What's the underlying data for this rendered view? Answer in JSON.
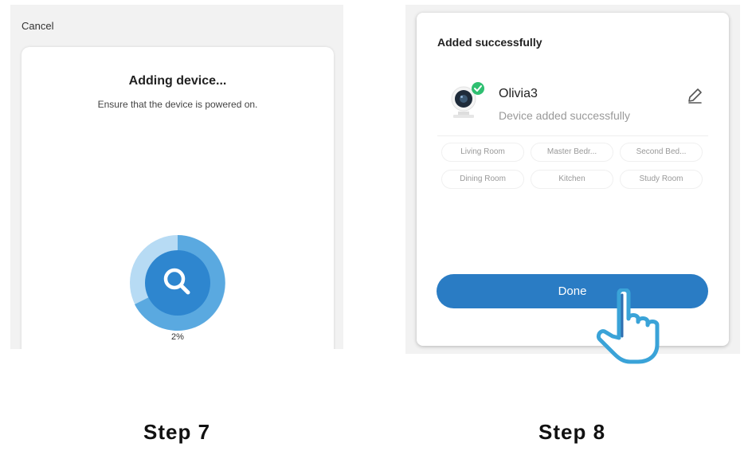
{
  "step7": {
    "cancel_label": "Cancel",
    "title": "Adding device...",
    "subtitle": "Ensure that the device is powered on.",
    "progress_text": "2%",
    "progress_fraction": 0.02
  },
  "step8": {
    "title": "Added successfully",
    "device_name": "Olivia3",
    "device_status": "Device added successfully",
    "rooms": [
      "Living Room",
      "Master Bedr...",
      "Second Bed...",
      "Dining Room",
      "Kitchen",
      "Study Room"
    ],
    "done_label": "Done"
  },
  "labels": {
    "step7": "Step 7",
    "step8": "Step 8"
  },
  "colors": {
    "accent_blue": "#2a7cc4",
    "success_green": "#2fbf71",
    "spinner_dark": "#2e86cf",
    "spinner_light": "#b7dbf4"
  },
  "icons": {
    "search": "search-icon",
    "edit": "pencil-icon",
    "check": "check-icon",
    "camera": "camera-icon",
    "hand": "hand-pointer-icon"
  }
}
